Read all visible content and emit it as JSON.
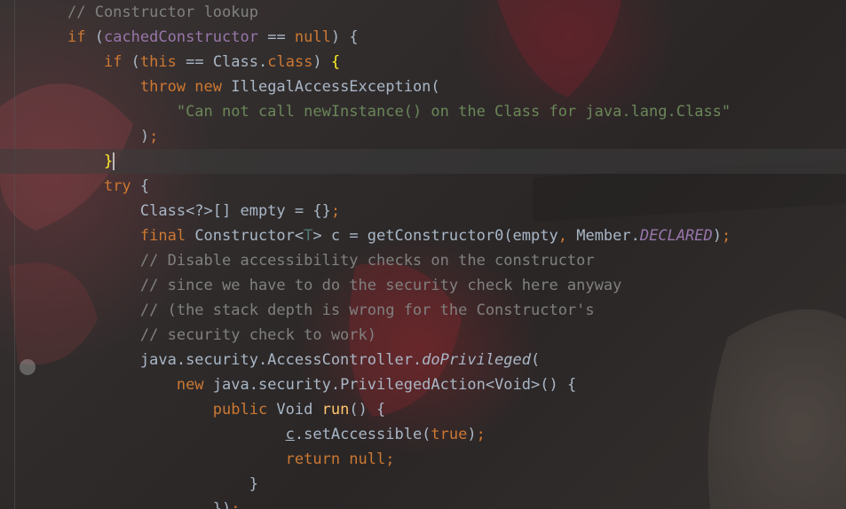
{
  "editor": {
    "lines": [
      {
        "indent": "",
        "tokens": [
          {
            "t": "// Constructor lookup",
            "c": "cm"
          }
        ]
      },
      {
        "indent": "",
        "tokens": [
          {
            "t": "if",
            "c": "kw"
          },
          {
            "t": " (",
            "c": "id"
          },
          {
            "t": "cachedConstructor",
            "c": "fld"
          },
          {
            "t": " == ",
            "c": "id"
          },
          {
            "t": "null",
            "c": "kw"
          },
          {
            "t": ") {",
            "c": "id"
          }
        ]
      },
      {
        "indent": "    ",
        "tokens": [
          {
            "t": "if",
            "c": "kw"
          },
          {
            "t": " (",
            "c": "id"
          },
          {
            "t": "this",
            "c": "kw"
          },
          {
            "t": " == Class.",
            "c": "id"
          },
          {
            "t": "class",
            "c": "kw"
          },
          {
            "t": ") ",
            "c": "id"
          },
          {
            "t": "{",
            "c": "bracket-match"
          }
        ]
      },
      {
        "indent": "        ",
        "tokens": [
          {
            "t": "throw new",
            "c": "kw"
          },
          {
            "t": " IllegalAccessException(",
            "c": "id"
          }
        ]
      },
      {
        "indent": "            ",
        "tokens": [
          {
            "t": "\"Can not call newInstance() on the Class for java.lang.Class\"",
            "c": "str"
          }
        ]
      },
      {
        "indent": "        ",
        "tokens": [
          {
            "t": ")",
            "c": "id"
          },
          {
            "t": ";",
            "c": "kw"
          }
        ]
      },
      {
        "indent": "    ",
        "tokens": [
          {
            "t": "}",
            "c": "bracket-match"
          },
          {
            "t": "",
            "c": "caret"
          }
        ]
      },
      {
        "indent": "    ",
        "tokens": [
          {
            "t": "try",
            "c": "kw"
          },
          {
            "t": " {",
            "c": "id"
          }
        ]
      },
      {
        "indent": "        ",
        "tokens": [
          {
            "t": "Class<?>[] empty = {}",
            "c": "id"
          },
          {
            "t": ";",
            "c": "kw"
          }
        ]
      },
      {
        "indent": "        ",
        "tokens": [
          {
            "t": "final",
            "c": "kw"
          },
          {
            "t": " Constructor<",
            "c": "id"
          },
          {
            "t": "T",
            "c": "typeparam"
          },
          {
            "t": "> c = getConstructor0(empty",
            "c": "id"
          },
          {
            "t": ",",
            "c": "kw"
          },
          {
            "t": " Member.",
            "c": "id"
          },
          {
            "t": "DECLARED",
            "c": "fld ital"
          },
          {
            "t": ")",
            "c": "id"
          },
          {
            "t": ";",
            "c": "kw"
          }
        ]
      },
      {
        "indent": "        ",
        "tokens": [
          {
            "t": "// Disable accessibility checks on the constructor",
            "c": "cm"
          }
        ]
      },
      {
        "indent": "        ",
        "tokens": [
          {
            "t": "// since we have to do the security check here anyway",
            "c": "cm"
          }
        ]
      },
      {
        "indent": "        ",
        "tokens": [
          {
            "t": "// (the stack depth is wrong for the Constructor's",
            "c": "cm"
          }
        ]
      },
      {
        "indent": "        ",
        "tokens": [
          {
            "t": "// security check to work)",
            "c": "cm"
          }
        ]
      },
      {
        "indent": "        ",
        "tokens": [
          {
            "t": "java.security.AccessController.",
            "c": "id"
          },
          {
            "t": "doPrivileged",
            "c": "ital"
          },
          {
            "t": "(",
            "c": "id"
          }
        ]
      },
      {
        "indent": "            ",
        "tokens": [
          {
            "t": "new",
            "c": "kw"
          },
          {
            "t": " java.security.PrivilegedAction<Void>() {",
            "c": "id"
          }
        ]
      },
      {
        "indent": "                ",
        "tokens": [
          {
            "t": "public",
            "c": "kw"
          },
          {
            "t": " Void ",
            "c": "id"
          },
          {
            "t": "run",
            "c": "fn"
          },
          {
            "t": "() {",
            "c": "id"
          }
        ]
      },
      {
        "indent": "                        ",
        "tokens": [
          {
            "t": "c",
            "c": "ul"
          },
          {
            "t": ".setAccessible(",
            "c": "id"
          },
          {
            "t": "true",
            "c": "kw"
          },
          {
            "t": ")",
            "c": "id"
          },
          {
            "t": ";",
            "c": "kw"
          }
        ]
      },
      {
        "indent": "                        ",
        "tokens": [
          {
            "t": "return null",
            "c": "kw"
          },
          {
            "t": ";",
            "c": "kw"
          }
        ]
      },
      {
        "indent": "                    ",
        "tokens": [
          {
            "t": "}",
            "c": "id"
          }
        ]
      },
      {
        "indent": "                ",
        "tokens": [
          {
            "t": "})",
            "c": "id"
          },
          {
            "t": ";",
            "c": "kw"
          }
        ]
      }
    ],
    "current_line_index": 6,
    "colors": {
      "keyword": "#cc7832",
      "comment": "#808080",
      "string": "#6a8759",
      "field": "#9876aa",
      "function": "#ffc66d",
      "bracket_match": "#ffef28",
      "text": "#a9b7c6"
    }
  }
}
